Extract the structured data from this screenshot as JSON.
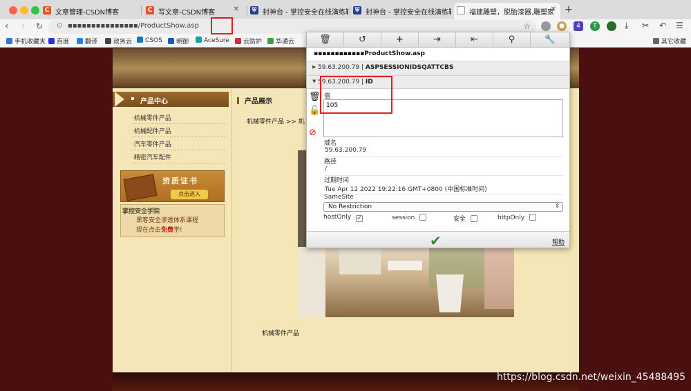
{
  "tabs": [
    {
      "label": "文章管理-CSDN博客",
      "icon": "csdn-icon",
      "fav": "C"
    },
    {
      "label": "写文章-CSDN博客",
      "icon": "csdn-icon",
      "fav": "C"
    },
    {
      "label": "封神台 - 掌控安全在线演练靶",
      "icon": "shield-site-icon",
      "fav": ""
    },
    {
      "label": "封神台 - 掌控安全在线演练靶",
      "icon": "shield-site-icon",
      "fav": ""
    },
    {
      "label": "福建雕塑，脱胎漆器,雕塑家",
      "icon": "document-icon",
      "fav": ""
    }
  ],
  "toolbar": {
    "url": "▪▪▪▪▪▪▪▪▪▪▪▪▪▪▪/ProductShow.asp",
    "ext_badge": "4",
    "ext_letter": "T"
  },
  "bookmarks": [
    {
      "label": "手机收藏夹",
      "color": "#3a6fd8"
    },
    {
      "label": "百度",
      "color": "#2932e1"
    },
    {
      "label": "翻译",
      "color": "#2b7de9"
    },
    {
      "label": "政务云",
      "color": "#444444"
    },
    {
      "label": "CSOS",
      "color": "#1a78c2"
    },
    {
      "label": "明御",
      "color": "#1a5ab8"
    },
    {
      "label": "AceSure",
      "color": "#18a0a0"
    },
    {
      "label": "云防护",
      "color": "#d03030"
    },
    {
      "label": "华通云",
      "color": "#3aa040"
    },
    {
      "label": "其它收藏",
      "color": "#666666"
    }
  ],
  "site": {
    "sidebar_title": "产品中心",
    "sidebar_links": [
      "·机械零件产品",
      "·机械配件产品",
      "·汽车零件产品",
      "·精密汽车配件"
    ],
    "cert_title": "资质证书",
    "cert_button": "点击进入",
    "ad_title": "掌控安全学院",
    "ad_line1": "黑客安全渗透体系课程",
    "ad_line2_prefix": "现在点击",
    "ad_line2_red": "免费",
    "ad_line2_suffix": "学!",
    "main_title": "产品展示",
    "breadcrumb": "机械零件产品 >> 机",
    "caption": "机械零件产品"
  },
  "cookie_panel": {
    "tools": [
      "trash-icon",
      "undo-icon",
      "plus-icon",
      "import-icon",
      "export-icon",
      "search-icon",
      "wrench-icon"
    ],
    "page_url": "▪▪▪▪▪▪▪▪▪▪▪▪ProductShow.asp",
    "cookie1_domain": "59.63.200.79",
    "cookie1_name": "ASPSESSIONIDSQATTCBS",
    "cookie2_domain": "59.63.200.79",
    "cookie2_name": "ID",
    "value_label": "值",
    "value": "105",
    "domain_label": "域名",
    "domain": "59.63.200.79",
    "path_label": "路径",
    "path": "/",
    "expires_label": "过期时间",
    "expires": "Tue Apr 12 2022 19:22:16 GMT+0800 (中国标准时间)",
    "samesite_label": "SameSite",
    "samesite": "No Restriction",
    "hostonly_label": "hostOnly",
    "session_label": "session",
    "secure_label": "安全",
    "httponly_label": "httpOnly",
    "help_label": "帮助"
  },
  "watermark": "https://blog.csdn.net/weixin_45488495"
}
